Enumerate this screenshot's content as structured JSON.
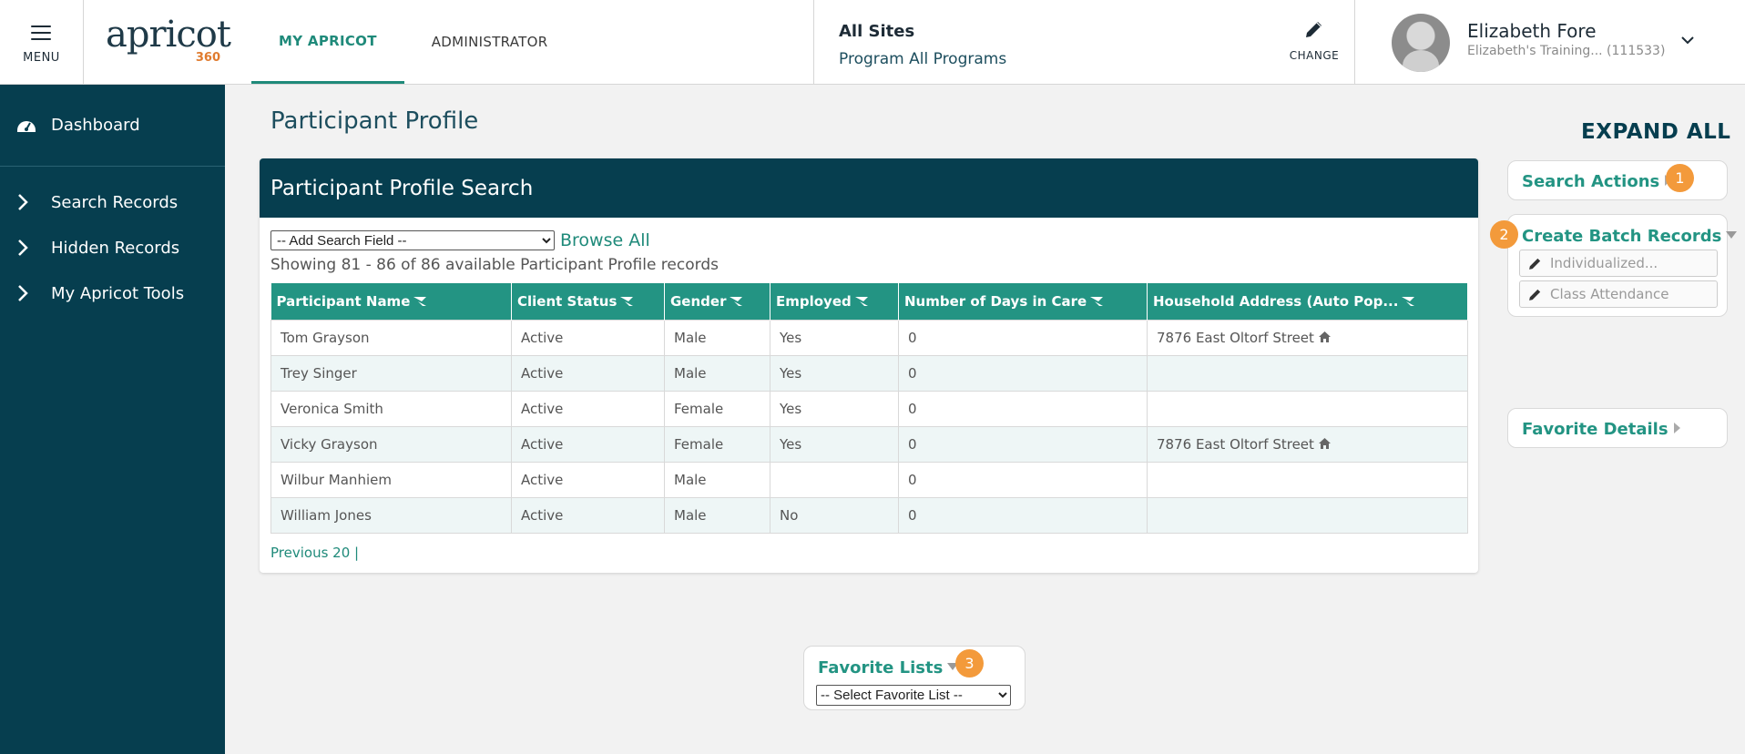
{
  "header": {
    "menu_label": "MENU",
    "logo_word": "apricot",
    "logo_num": "360",
    "tabs": [
      {
        "label": "MY APRICOT",
        "active": true
      },
      {
        "label": "ADMINISTRATOR",
        "active": false
      }
    ],
    "site": "All Sites",
    "program": "Program All Programs",
    "change_label": "CHANGE",
    "user_name": "Elizabeth Fore",
    "user_org": "Elizabeth's Training...  (111533)"
  },
  "sidebar": {
    "items": [
      {
        "label": "Dashboard",
        "icon": "dashboard-icon"
      },
      {
        "label": "Search Records",
        "icon": "chevron-right-icon"
      },
      {
        "label": "Hidden Records",
        "icon": "chevron-right-icon"
      },
      {
        "label": "My Apricot Tools",
        "icon": "chevron-right-icon"
      }
    ]
  },
  "main": {
    "page_title": "Participant Profile",
    "card_title": "Participant Profile Search",
    "add_field_selected": "-- Add Search Field --",
    "browse_all": "Browse All",
    "showing": "Showing 81 - 86 of 86 available Participant Profile records",
    "columns": [
      "Participant Name",
      "Client Status",
      "Gender",
      "Employed",
      "Number of Days in Care",
      "Household Address (Auto Pop..."
    ],
    "rows": [
      [
        "Tom Grayson",
        "Active",
        "Male",
        "Yes",
        "0",
        "7876 East Oltorf Street"
      ],
      [
        "Trey Singer",
        "Active",
        "Male",
        "Yes",
        "0",
        ""
      ],
      [
        "Veronica Smith",
        "Active",
        "Female",
        "Yes",
        "0",
        ""
      ],
      [
        "Vicky Grayson",
        "Active",
        "Female",
        "Yes",
        "0",
        "7876 East Oltorf Street"
      ],
      [
        "Wilbur Manhiem",
        "Active",
        "Male",
        "",
        "0",
        ""
      ],
      [
        "William Jones",
        "Active",
        "Male",
        "No",
        "0",
        ""
      ]
    ],
    "pager": "Previous 20 |"
  },
  "right": {
    "expand_all": "EXPAND ALL",
    "search_actions": "Search Actions",
    "create_batch": "Create Batch Records",
    "batch_buttons": [
      "Individualized...",
      "Class Attendance"
    ],
    "favorite_details": "Favorite Details",
    "badges": [
      "1",
      "2",
      "3"
    ]
  },
  "favorites": {
    "title": "Favorite Lists",
    "select_selected": "-- Select Favorite List --"
  },
  "colors": {
    "navy": "#063e4f",
    "teal": "#239483",
    "orange": "#f39a3b"
  }
}
